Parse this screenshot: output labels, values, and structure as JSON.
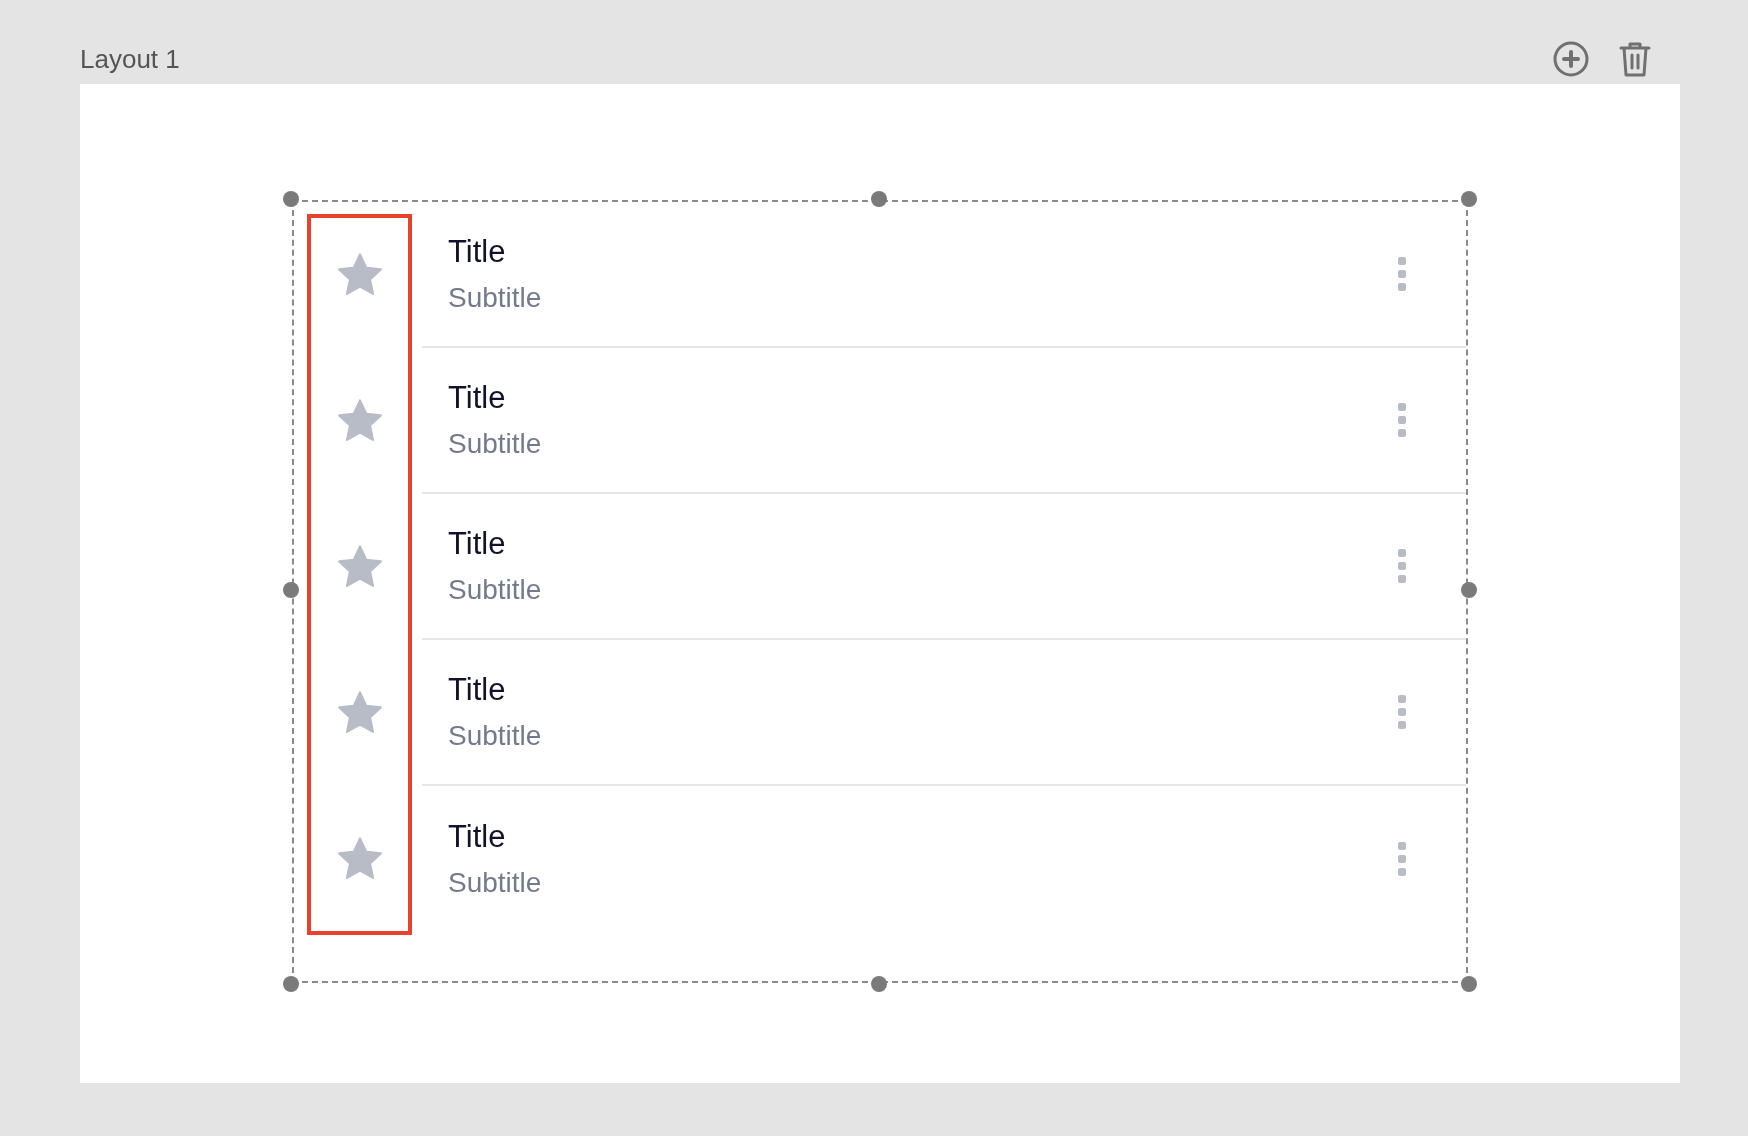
{
  "layout": {
    "title": "Layout 1"
  },
  "items": [
    {
      "title": "Title",
      "subtitle": "Subtitle"
    },
    {
      "title": "Title",
      "subtitle": "Subtitle"
    },
    {
      "title": "Title",
      "subtitle": "Subtitle"
    },
    {
      "title": "Title",
      "subtitle": "Subtitle"
    },
    {
      "title": "Title",
      "subtitle": "Subtitle"
    }
  ]
}
